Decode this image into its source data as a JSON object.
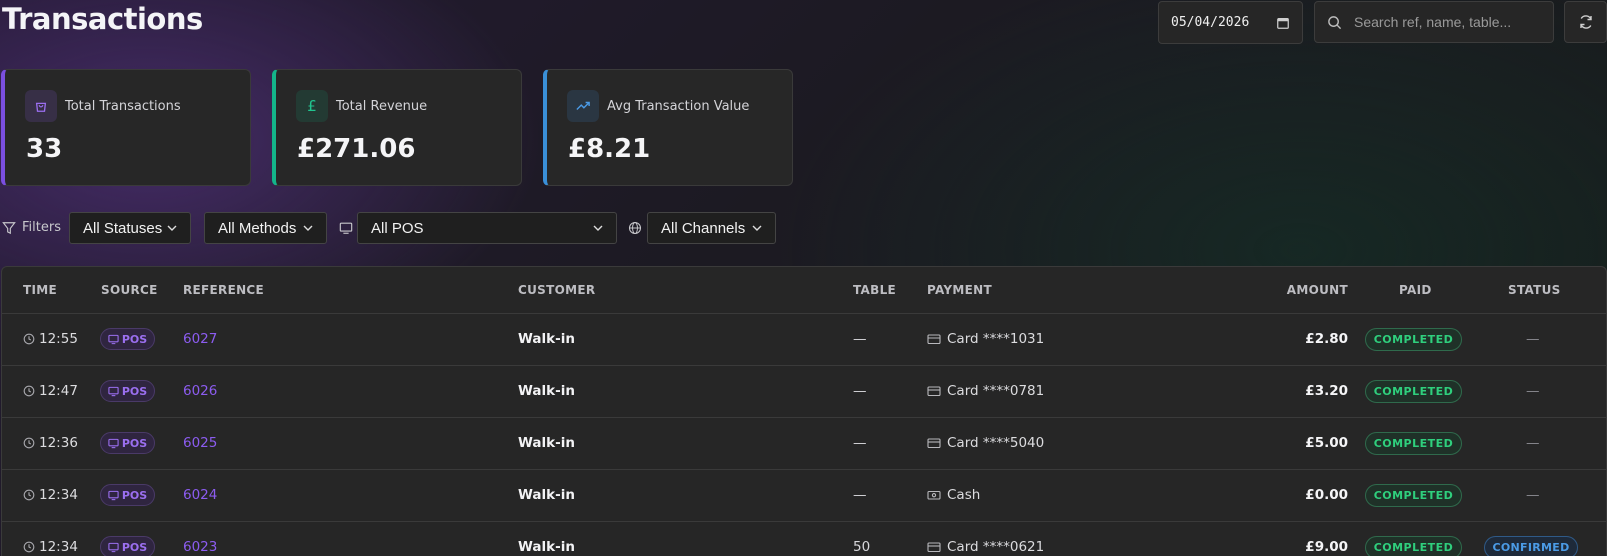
{
  "header": {
    "title": "Transactions",
    "date_value": "05/04/2026",
    "search_placeholder": "Search ref, name, table...",
    "icons": [
      "calendar-icon",
      "search-icon",
      "refresh-icon"
    ]
  },
  "stats": [
    {
      "label": "Total Transactions",
      "value": "33",
      "icon": "shopping-bag-icon",
      "accent": "#7b4fe0"
    },
    {
      "label": "Total Revenue",
      "value": "£271.06",
      "icon": "pound-icon",
      "accent": "#14b48a"
    },
    {
      "label": "Avg Transaction Value",
      "value": "£8.21",
      "icon": "trending-up-icon",
      "accent": "#3a8fd8"
    }
  ],
  "filters": {
    "label": "Filters",
    "status": "All Statuses",
    "methods": "All Methods",
    "pos": "All POS",
    "channels": "All Channels"
  },
  "table": {
    "columns": [
      "TIME",
      "SOURCE",
      "REFERENCE",
      "CUSTOMER",
      "TABLE",
      "PAYMENT",
      "AMOUNT",
      "PAID",
      "STATUS"
    ],
    "rows": [
      {
        "time": "12:55",
        "source": "POS",
        "reference": "6027",
        "customer": "Walk-in",
        "table": "—",
        "payment": "Card ****1031",
        "payment_type": "card",
        "amount": "£2.80",
        "paid": "COMPLETED",
        "status": "—"
      },
      {
        "time": "12:47",
        "source": "POS",
        "reference": "6026",
        "customer": "Walk-in",
        "table": "—",
        "payment": "Card ****0781",
        "payment_type": "card",
        "amount": "£3.20",
        "paid": "COMPLETED",
        "status": "—"
      },
      {
        "time": "12:36",
        "source": "POS",
        "reference": "6025",
        "customer": "Walk-in",
        "table": "—",
        "payment": "Card ****5040",
        "payment_type": "card",
        "amount": "£5.00",
        "paid": "COMPLETED",
        "status": "—"
      },
      {
        "time": "12:34",
        "source": "POS",
        "reference": "6024",
        "customer": "Walk-in",
        "table": "—",
        "payment": "Cash",
        "payment_type": "cash",
        "amount": "£0.00",
        "paid": "COMPLETED",
        "status": "—"
      },
      {
        "time": "12:34",
        "source": "POS",
        "reference": "6023",
        "customer": "Walk-in",
        "table": "50",
        "payment": "Card ****0621",
        "payment_type": "card",
        "amount": "£9.00",
        "paid": "COMPLETED",
        "status": "CONFIRMED"
      }
    ]
  },
  "colors": {
    "purple": "#8c5cf0",
    "green": "#2fcf7d",
    "blue": "#4b9be6"
  }
}
